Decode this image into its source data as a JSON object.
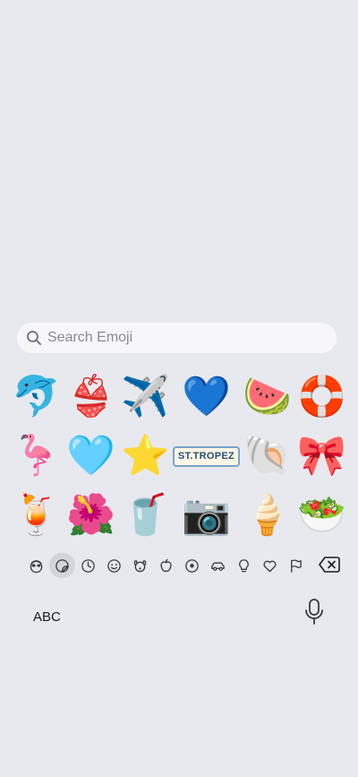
{
  "search": {
    "placeholder": "Search Emoji",
    "icon": "search-icon"
  },
  "stickers": [
    {
      "name": "dolphin",
      "glyph": "🐬"
    },
    {
      "name": "bikini",
      "glyph": "👙"
    },
    {
      "name": "airplane",
      "glyph": "✈️"
    },
    {
      "name": "blue-heart-sparkles",
      "glyph": "💙"
    },
    {
      "name": "watermelon",
      "glyph": "🍉"
    },
    {
      "name": "life-ring",
      "glyph": "🛟"
    },
    {
      "name": "flamingo-float",
      "glyph": "🦩"
    },
    {
      "name": "cloud-heart",
      "glyph": "🩵"
    },
    {
      "name": "starfish",
      "glyph": "⭐"
    },
    {
      "name": "license-plate",
      "text": "ST.TROPEZ"
    },
    {
      "name": "seashell",
      "glyph": "🐚"
    },
    {
      "name": "blue-bow",
      "glyph": "🎀"
    },
    {
      "name": "spritz-cocktail",
      "glyph": "🍹"
    },
    {
      "name": "hibiscus",
      "glyph": "🌺"
    },
    {
      "name": "iced-drink",
      "glyph": "🥤"
    },
    {
      "name": "camera",
      "glyph": "📷"
    },
    {
      "name": "popsicle",
      "glyph": "🍦"
    },
    {
      "name": "fruit-bowl",
      "glyph": "🥗"
    }
  ],
  "categories": [
    {
      "name": "memoji-icon"
    },
    {
      "name": "stickers-icon",
      "active": true
    },
    {
      "name": "recent-clock-icon"
    },
    {
      "name": "smiley-icon"
    },
    {
      "name": "animal-icon"
    },
    {
      "name": "food-apple-icon"
    },
    {
      "name": "soccer-ball-icon"
    },
    {
      "name": "car-icon"
    },
    {
      "name": "lightbulb-icon"
    },
    {
      "name": "heart-icon"
    },
    {
      "name": "flag-icon"
    }
  ],
  "keyboard": {
    "abc_label": "ABC"
  },
  "colors": {
    "background": "#e8e9ee",
    "search_bg": "#f7f7f9",
    "icon": "#3a3a3c"
  }
}
